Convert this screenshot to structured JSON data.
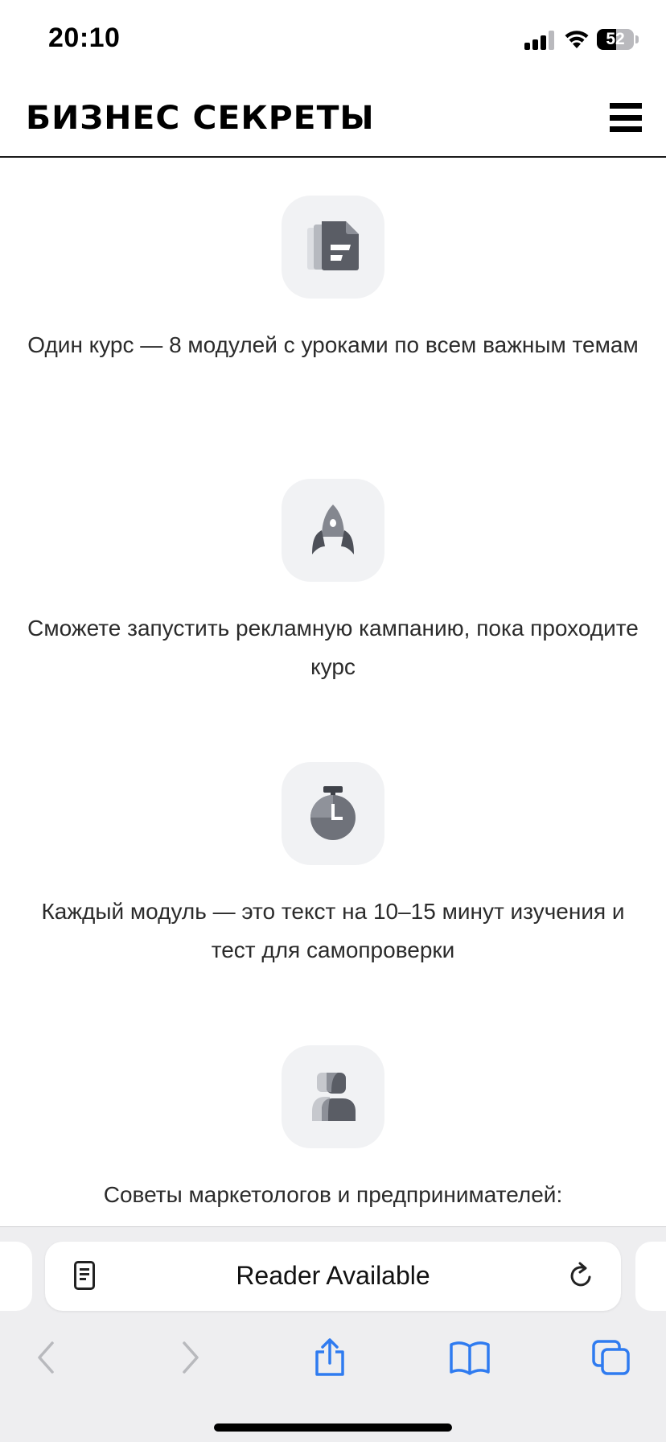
{
  "status_bar": {
    "time": "20:10",
    "battery": "52",
    "battery_level": 0.52
  },
  "header": {
    "logo": "БИЗНЕС СЕКРЕТЫ",
    "menu_icon": "hamburger-menu-icon"
  },
  "features": [
    {
      "icon": "documents-icon",
      "text": "Один курс — 8 модулей с уроками по всем важным темам"
    },
    {
      "icon": "rocket-icon",
      "text": "Сможете запустить рекламную кампанию, пока проходите курс"
    },
    {
      "icon": "stopwatch-icon",
      "text": "Каждый модуль — это текст на 10–15 минут изучения и тест для самопроверки"
    },
    {
      "icon": "people-icon",
      "text": "Советы маркетологов и предпринимателей:"
    }
  ],
  "browser": {
    "address_text": "Reader Available",
    "reader_icon": "reader-icon",
    "reload_icon": "reload-icon",
    "toolbar": [
      "back-icon",
      "forward-icon",
      "share-icon",
      "bookmarks-icon",
      "tabs-icon"
    ]
  },
  "colors": {
    "accent": "#2f7bf0",
    "icon_dark": "#55585f",
    "icon_light": "#bfc2c8",
    "tile_bg": "#f1f2f4"
  }
}
